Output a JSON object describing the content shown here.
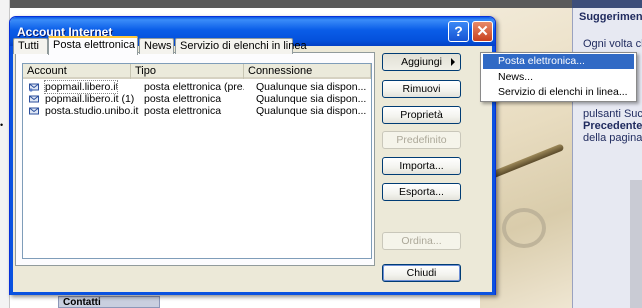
{
  "background": {
    "right_panel_title": "Suggerimen",
    "right_panel_lines": [
      {
        "text": "Ogni volta ch",
        "bold": false
      },
      {
        "text": "pulsanti Suc",
        "bold": false
      },
      {
        "text": "Precedente",
        "bold": true
      },
      {
        "text": "della pagina.",
        "bold": false
      }
    ],
    "bottom_tab": "Contatti"
  },
  "dialog": {
    "title": "Account Internet",
    "help_symbol": "?",
    "close_symbol": "✕",
    "tabs": [
      {
        "label": "Tutti",
        "active": false
      },
      {
        "label": "Posta elettronica",
        "active": true
      },
      {
        "label": "News",
        "active": false
      },
      {
        "label": "Servizio di elenchi in linea",
        "active": false
      }
    ],
    "columns": [
      "Account",
      "Tipo",
      "Connessione"
    ],
    "accounts": [
      {
        "account": "popmail.libero.it",
        "tipo": "posta elettronica (pre...",
        "connessione": "Qualunque sia dispon..."
      },
      {
        "account": "popmail.libero.it (1)",
        "tipo": "posta elettronica",
        "connessione": "Qualunque sia dispon..."
      },
      {
        "account": "posta.studio.unibo.it",
        "tipo": "posta elettronica",
        "connessione": "Qualunque sia dispon..."
      }
    ],
    "buttons": {
      "aggiungi": "Aggiungi",
      "rimuovi": "Rimuovi",
      "proprieta": "Proprietà",
      "predefinito": "Predefinito",
      "importa": "Importa...",
      "esporta": "Esporta...",
      "ordina": "Ordina...",
      "chiudi": "Chiudi"
    }
  },
  "menu": {
    "items": [
      "Posta elettronica...",
      "News...",
      "Servizio di elenchi in linea..."
    ],
    "highlighted": 0
  },
  "colors": {
    "titlebar": "#0a5de8",
    "menu_highlight": "#316ac5",
    "active_tab_accent": "#ffc83c"
  }
}
